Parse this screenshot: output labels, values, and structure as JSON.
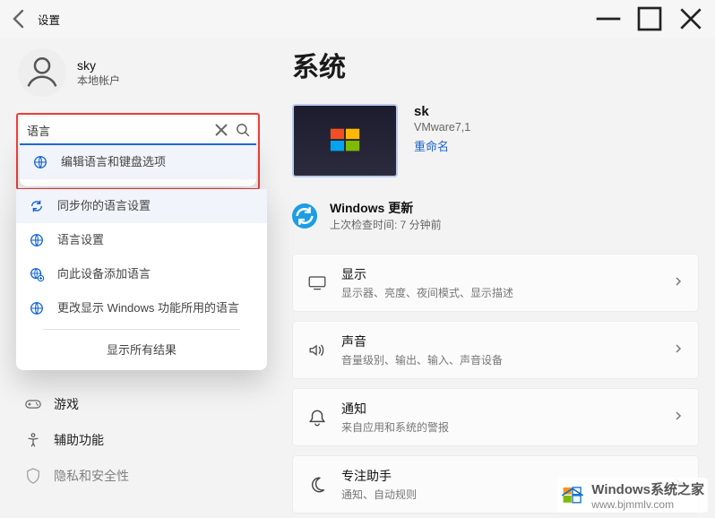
{
  "titlebar": {
    "title": "设置"
  },
  "profile": {
    "name": "sky",
    "sub": "本地帐户"
  },
  "search": {
    "value": "语言",
    "results": [
      "编辑语言和键盘选项",
      "同步你的语言设置",
      "语言设置",
      "向此设备添加语言",
      "更改显示 Windows 功能所用的语言"
    ],
    "show_all": "显示所有结果"
  },
  "nav_below": [
    {
      "label": "游戏",
      "icon": "gamepad"
    },
    {
      "label": "辅助功能",
      "icon": "accessibility"
    },
    {
      "label": "隐私和安全性",
      "icon": "shield"
    }
  ],
  "page": {
    "title": "系统",
    "pc": {
      "name": "sk",
      "model": "VMware7,1",
      "rename": "重命名"
    },
    "update": {
      "title": "Windows 更新",
      "sub": "上次检查时间: 7 分钟前"
    },
    "cards": [
      {
        "title": "显示",
        "sub": "显示器、亮度、夜间模式、显示描述",
        "icon": "monitor"
      },
      {
        "title": "声音",
        "sub": "音量级别、输出、输入、声音设备",
        "icon": "sound"
      },
      {
        "title": "通知",
        "sub": "来自应用和系统的警报",
        "icon": "bell"
      },
      {
        "title": "专注助手",
        "sub": "通知、自动规则",
        "icon": "moon"
      }
    ]
  },
  "watermark": {
    "head": "Windows系统之家",
    "url": "www.bjmmlv.com"
  }
}
